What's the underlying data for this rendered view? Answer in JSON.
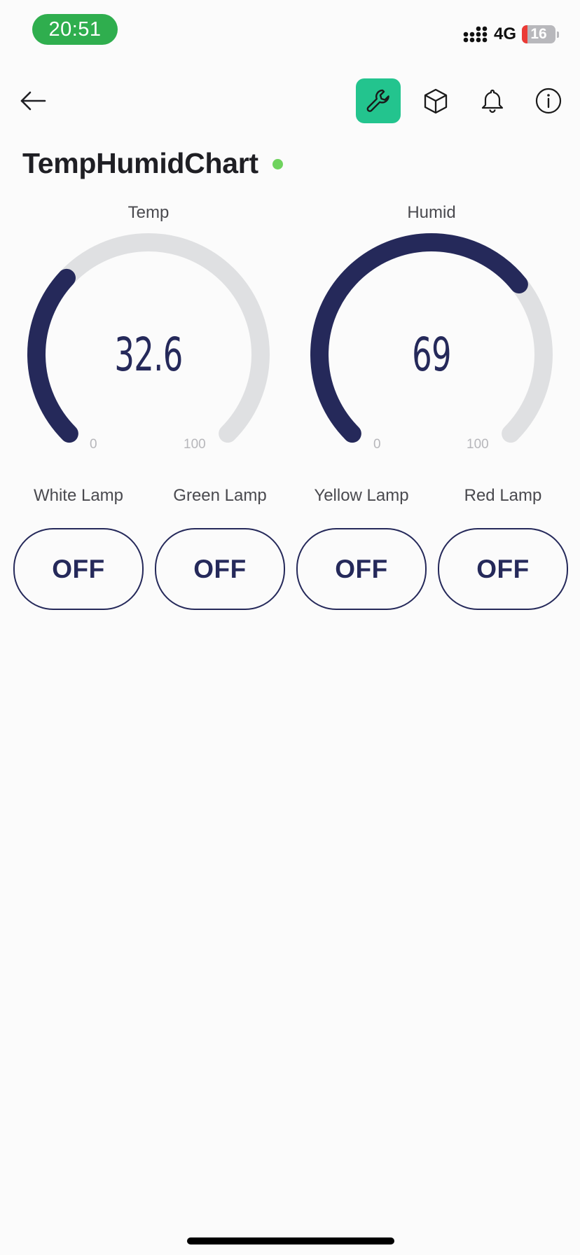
{
  "status_bar": {
    "time": "20:51",
    "network": "4G",
    "battery_level": "16",
    "battery_fraction": 0.16
  },
  "header": {
    "back_icon": "arrow-left-icon",
    "toolbar": [
      {
        "icon": "wrench-icon",
        "active": true
      },
      {
        "icon": "cube-icon",
        "active": false
      },
      {
        "icon": "bell-icon",
        "active": false
      },
      {
        "icon": "info-icon",
        "active": false
      }
    ]
  },
  "device": {
    "title": "TempHumidChart",
    "status_color": "#6fd35e"
  },
  "gauges": [
    {
      "label": "Temp",
      "value": "32.6",
      "numeric_value": 32.6,
      "min": "0",
      "max": "100"
    },
    {
      "label": "Humid",
      "value": "69",
      "numeric_value": 69,
      "min": "0",
      "max": "100"
    }
  ],
  "lamps": [
    {
      "label": "White Lamp",
      "state": "OFF"
    },
    {
      "label": "Green Lamp",
      "state": "OFF"
    },
    {
      "label": "Yellow Lamp",
      "state": "OFF"
    },
    {
      "label": "Red Lamp",
      "state": "OFF"
    }
  ],
  "colors": {
    "accent": "#23c48e",
    "widget": "#25295a",
    "track": "#dfe0e2",
    "status_time_bg": "#2fae4e"
  }
}
